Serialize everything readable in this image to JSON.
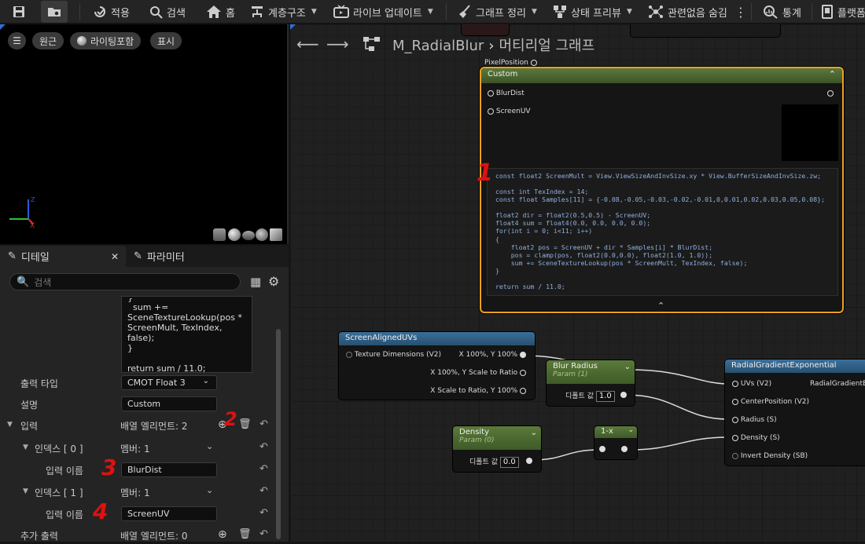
{
  "toolbar": {
    "apply": "적용",
    "search": "검색",
    "home": "홈",
    "hierarchy": "계층구조",
    "live_update": "라이브 업데이트",
    "clean_graph": "그래프 정리",
    "preview_state": "상태 프리뷰",
    "hide_unrelated": "관련없음 숨김",
    "stats": "통계",
    "platform": "플랫폼"
  },
  "viewport": {
    "perspective": "원근",
    "lit": "라이팅포함",
    "show": "표시",
    "axis_x": "X",
    "axis_z": "Z"
  },
  "details": {
    "tab_details": "디테일",
    "tab_params": "파라미터",
    "search_placeholder": "검색",
    "code_lines": [
      "{",
      "  sum +=",
      "SceneTextureLookup(pos *",
      "ScreenMult, TexIndex, false);",
      "}",
      "",
      "return sum / 11.0;"
    ],
    "output_type_label": "출력 타입",
    "output_type_value": "CMOT Float 3",
    "desc_label": "설명",
    "desc_value": "Custom",
    "inputs_label": "입력",
    "inputs_value": "배열 엘리먼트: 2",
    "index0_label": "인덱스 [ 0 ]",
    "index0_value": "멤버: 1",
    "name0_label": "입력 이름",
    "name0_value": "BlurDist",
    "index1_label": "인덱스 [ 1 ]",
    "index1_value": "멤버: 1",
    "name1_label": "입력 이름",
    "name1_value": "ScreenUV",
    "extra_out_label": "추가 출력",
    "extra_out_value": "배열 엘리먼트: 0"
  },
  "annotations": [
    "1",
    "2",
    "3",
    "4"
  ],
  "graph": {
    "breadcrumb_asset": "M_RadialBlur",
    "breadcrumb_graph": "머티리얼 그래프",
    "pixel_position": "PixelPosition",
    "custom": {
      "title": "Custom",
      "pins": [
        "BlurDist",
        "ScreenUV"
      ],
      "code": [
        "const float2 ScreenMult = View.ViewSizeAndInvSize.xy * View.BufferSizeAndInvSize.zw;",
        "",
        "const int TexIndex = 14;",
        "const float Samples[11] = {-0.08,-0.05,-0.03,-0.02,-0.01,0,0.01,0.02,0.03,0.05,0.08};",
        "",
        "float2 dir = float2(0.5,0.5) - ScreenUV;",
        "float4 sum = float4(0.0, 0.0, 0.0, 0.0);",
        "for(int i = 0; i<11; i++)",
        "{",
        "    float2 pos = ScreenUV + dir * Samples[i] * BlurDist;",
        "    pos = clamp(pos, float2(0.0,0.0), float2(1.0, 1.0));",
        "    sum += SceneTextureLookup(pos * ScreenMult, TexIndex, false);",
        "}",
        "",
        "return sum / 11.0;"
      ]
    },
    "uvs": {
      "title": "ScreenAlignedUVs",
      "in_pin": "Texture Dimensions (V2)",
      "out1": "X 100%, Y 100%",
      "out2": "X 100%, Y Scale to Ratio",
      "out3": "X Scale to Ratio, Y 100%"
    },
    "blur": {
      "title": "Blur Radius",
      "sub": "Param (1)",
      "default_label": "디폴트 값",
      "default_value": "1.0"
    },
    "density": {
      "title": "Density",
      "sub": "Param (0)",
      "default_label": "디폴트 값",
      "default_value": "0.0"
    },
    "oneminus": {
      "title": "1-x"
    },
    "radial": {
      "title": "RadialGradientExponential",
      "pins": [
        "UVs (V2)",
        "CenterPosition (V2)",
        "Radius (S)",
        "Density (S)",
        "Invert Density (SB)"
      ],
      "out": "RadialGradientEx"
    }
  }
}
